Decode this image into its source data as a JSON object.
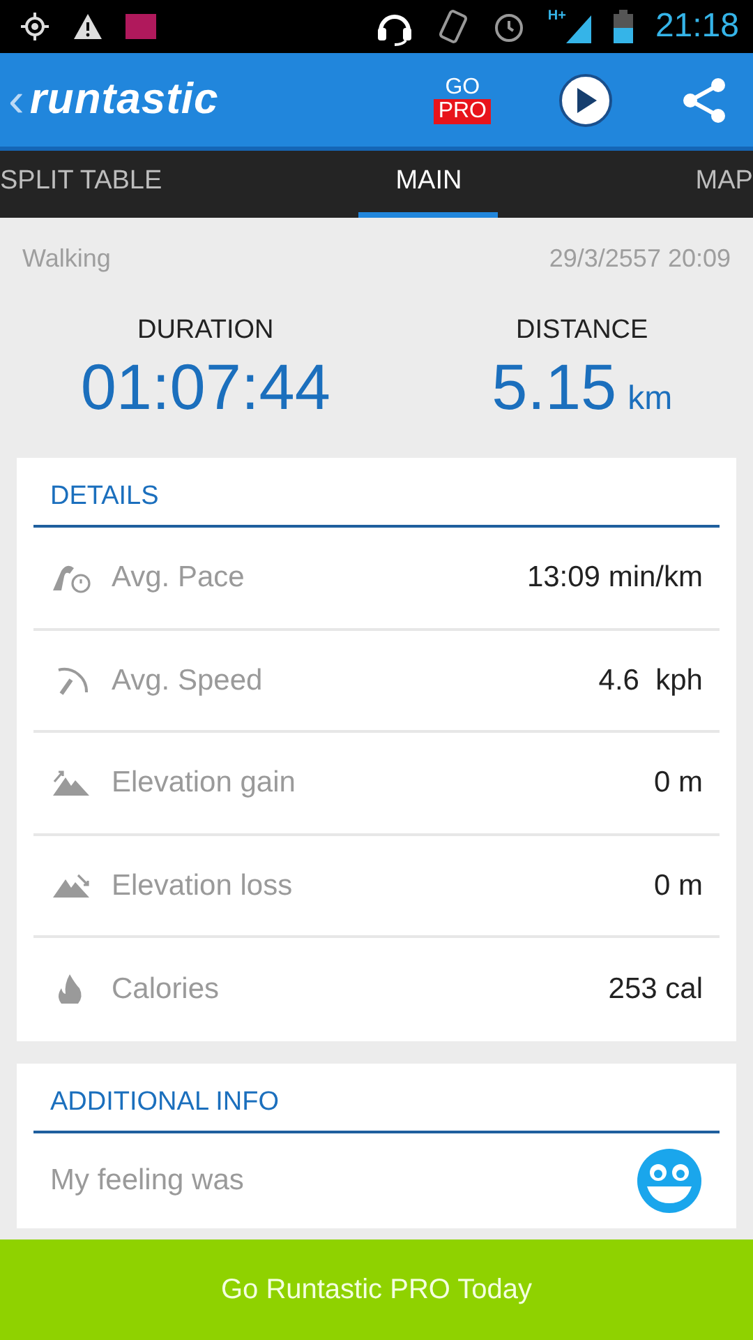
{
  "status_bar": {
    "network": "H+",
    "time": "21:18"
  },
  "app_bar": {
    "back": "‹",
    "logo": "runtastic",
    "go_pro": {
      "top": "GO",
      "badge": "PRO"
    }
  },
  "tabs": [
    {
      "label": "SPLIT TABLE",
      "selected": false
    },
    {
      "label": "MAIN",
      "selected": true
    },
    {
      "label": "MAP",
      "selected": false
    }
  ],
  "activity": {
    "type": "Walking",
    "date": "29/3/2557 20:09"
  },
  "summary": [
    {
      "label": "DURATION",
      "value": "01:07:44"
    },
    {
      "label": "DISTANCE",
      "value": "5.15",
      "unit": "km"
    }
  ],
  "details": {
    "title": "DETAILS",
    "rows": [
      {
        "kind": "pace",
        "label": "Avg. Pace",
        "value": "13:09 min/km"
      },
      {
        "kind": "speed",
        "label": "Avg. Speed",
        "value": "4.6  kph"
      },
      {
        "kind": "gain",
        "label": "Elevation gain",
        "value": "0 m"
      },
      {
        "kind": "loss",
        "label": "Elevation loss",
        "value": "0 m"
      },
      {
        "kind": "calories",
        "label": "Calories",
        "value": "253 cal"
      }
    ]
  },
  "additional_info": {
    "title": "ADDITIONAL INFO",
    "feeling_label": "My feeling was"
  },
  "promo_button": "Go Runtastic PRO Today"
}
